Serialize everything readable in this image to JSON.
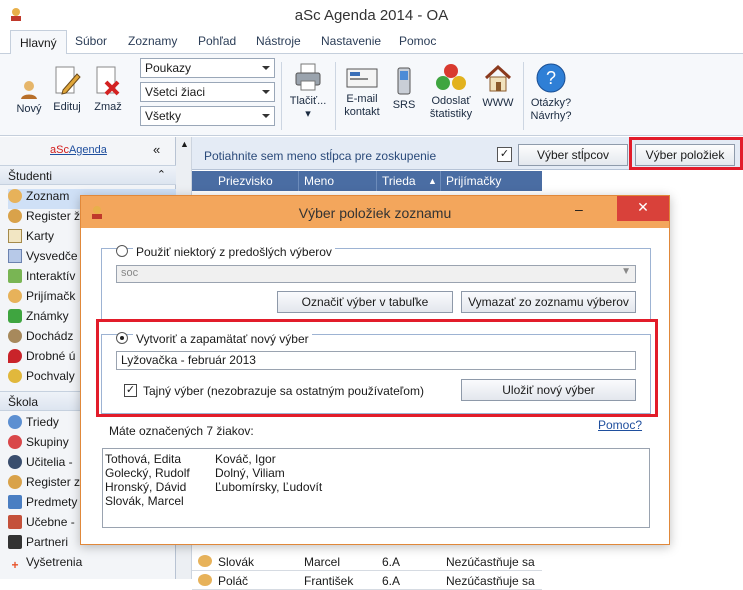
{
  "window": {
    "title": "aSc Agenda 2014 - OA"
  },
  "ribbon_tabs": [
    "Hlavný",
    "Súbor",
    "Zoznamy",
    "Pohľad",
    "Nástroje",
    "Nastavenie",
    "Pomoc"
  ],
  "ribbon": {
    "new": "Nový",
    "edit": "Edituj",
    "delete": "Zmaž",
    "combo1": "Poukazy",
    "combo2": "Všetci žiaci",
    "combo3": "Všetky",
    "print": "Tlačiť...",
    "email": "E-mail kontakt",
    "srs": "SRS",
    "send_stats": "Odoslať štatistiky",
    "www": "WWW",
    "questions": "Otázky? Návrhy?"
  },
  "sidebar": {
    "brand_prefix": "aSc",
    "brand_rest": "Agenda",
    "section_students": "Študenti",
    "students_items": [
      "Zoznam",
      "Register ž",
      "Karty",
      "Vysvedče",
      "Interaktív",
      "Prijímačk",
      "Známky",
      "Dochádz",
      "Drobné ú",
      "Pochvaly"
    ],
    "section_school": "Škola",
    "school_items": [
      "Triedy",
      "Skupiny",
      "Učitelia -",
      "Register z",
      "Predmety",
      "Učebne -",
      "Partneri",
      "Vyšetrenia"
    ]
  },
  "main": {
    "group_hint": "Potiahnite sem meno stĺpca pre zoskupenie",
    "select_columns": "Výber stĺpcov",
    "select_items": "Výber položiek",
    "columns": [
      "Priezvisko",
      "Meno",
      "Trieda",
      "Prijímačky"
    ],
    "rows": [
      {
        "surname": "Slovák",
        "name": "Marcel",
        "class": "6.A",
        "exam": "Nezúčastňuje sa"
      },
      {
        "surname": "Poláč",
        "name": "František",
        "class": "6.A",
        "exam": "Nezúčastňuje sa"
      }
    ]
  },
  "dialog": {
    "title": "Výber položiek zoznamu",
    "use_previous": "Použiť niektorý z predošlých výberov",
    "previous_value": "soc",
    "mark_in_table": "Označiť výber v tabuľke",
    "delete_from_list": "Vymazať zo zoznamu výberov",
    "create_new": "Vytvoriť a zapamätať nový výber",
    "new_name": "Lyžovačka - február 2013",
    "secret": "Tajný výber (nezobrazuje sa ostatným používateľom)",
    "save_new": "Uložiť nový výber",
    "help": "Pomoc?",
    "marked_count": "Máte označených 7 žiakov:",
    "students": [
      "Tothová, Edita",
      "Golecký, Rudolf",
      "Hronský, Dávid",
      "Slovák, Marcel",
      "Kováč, Igor",
      "Dolný, Viliam",
      "Ľubomírsky, Ľudovít"
    ]
  }
}
